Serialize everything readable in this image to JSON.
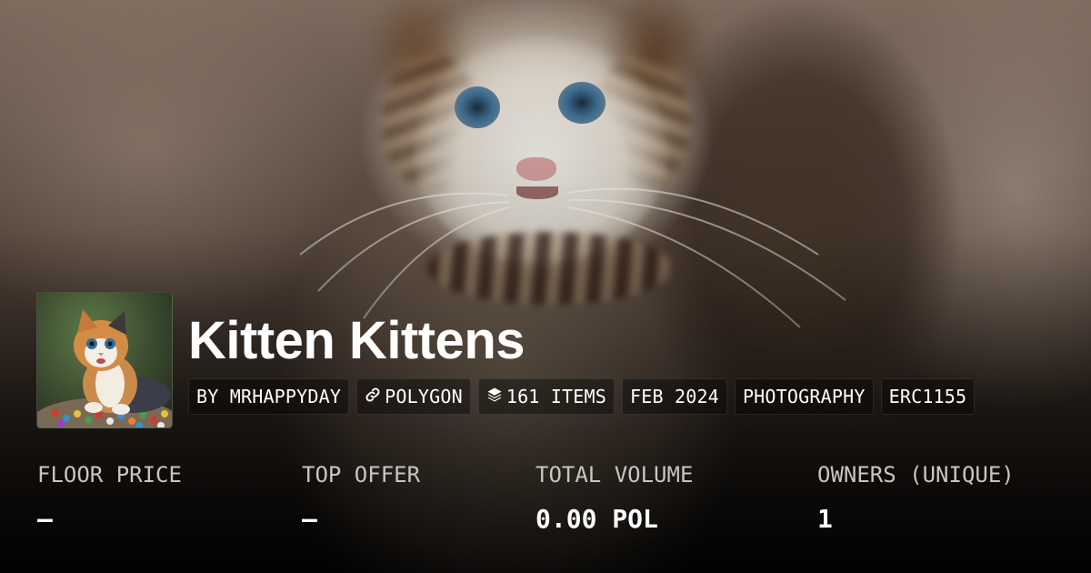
{
  "collection": {
    "name": "Kitten Kittens",
    "avatar_alt": "kitten-avatar"
  },
  "tags": [
    {
      "label": "BY MRHAPPYDAY",
      "icon": ""
    },
    {
      "label": "POLYGON",
      "icon": "chain-link-icon"
    },
    {
      "label": "161 ITEMS",
      "icon": "layers-icon"
    },
    {
      "label": "FEB 2024",
      "icon": ""
    },
    {
      "label": "PHOTOGRAPHY",
      "icon": ""
    },
    {
      "label": "ERC1155",
      "icon": ""
    }
  ],
  "stats": [
    {
      "label": "FLOOR PRICE",
      "value": "–"
    },
    {
      "label": "TOP OFFER",
      "value": "–"
    },
    {
      "label": "TOTAL VOLUME",
      "value": "0.00 POL"
    },
    {
      "label": "OWNERS (UNIQUE)",
      "value": "1"
    }
  ],
  "colors": {
    "text_primary": "#ffffff",
    "text_muted": "#c9c5c0",
    "tag_bg": "rgba(0,0,0,0.38)"
  }
}
